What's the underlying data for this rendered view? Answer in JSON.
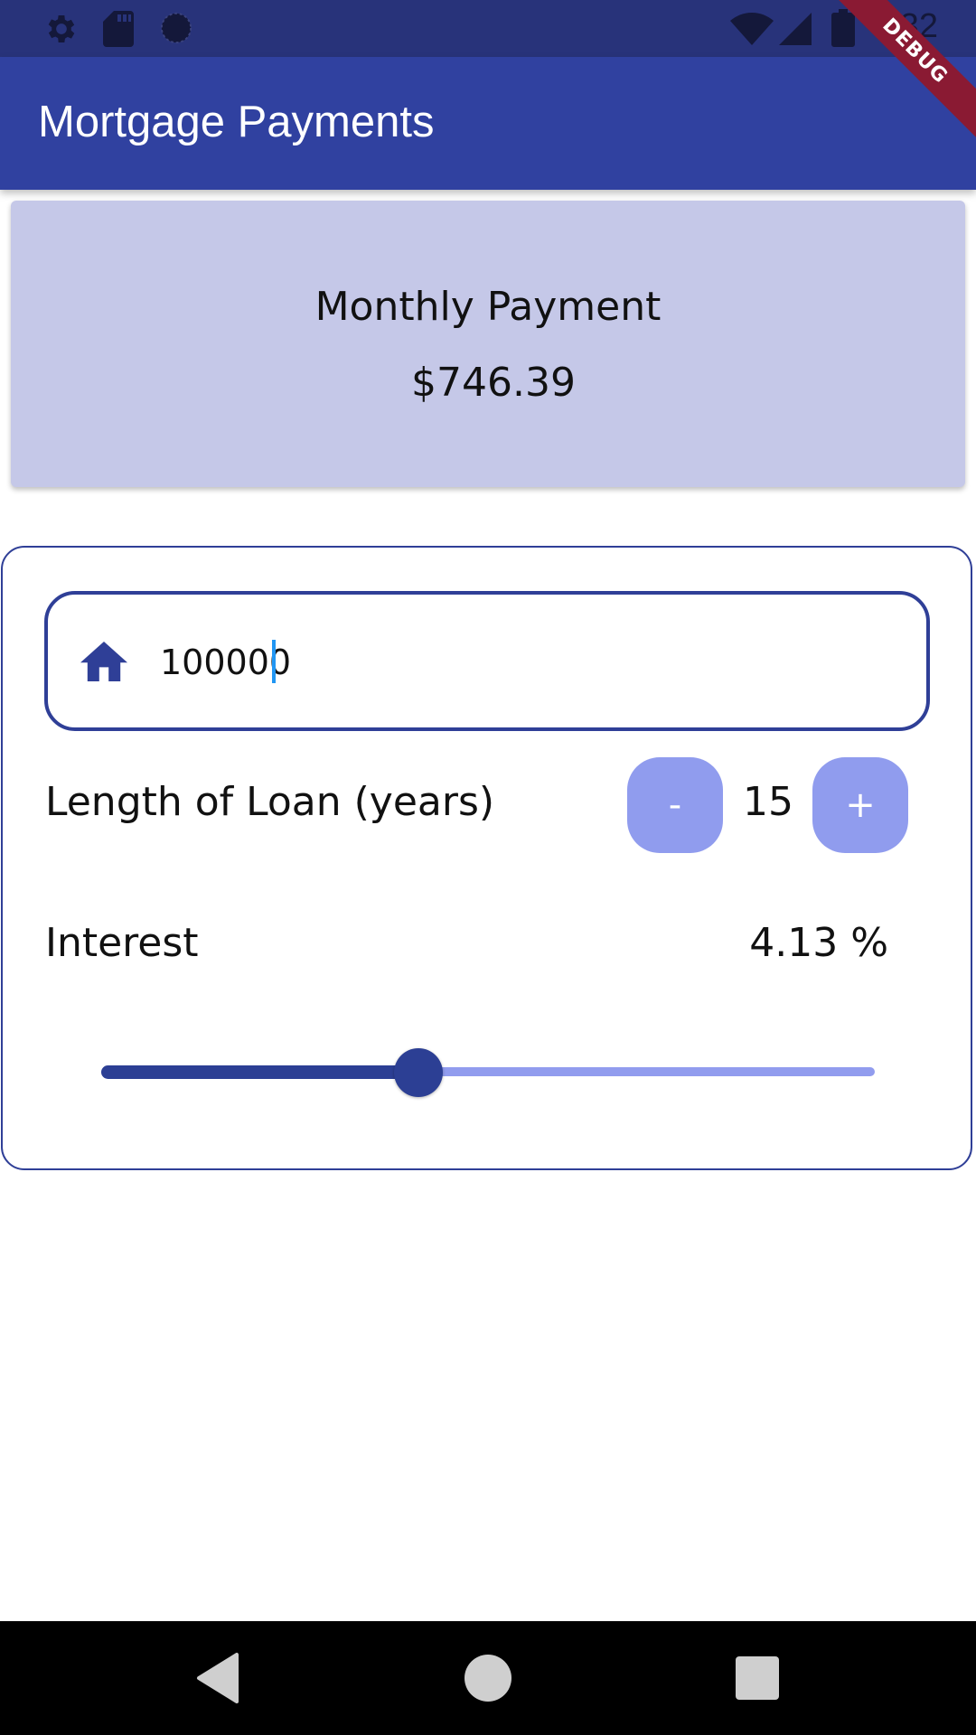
{
  "status_bar": {
    "time": "6:32",
    "icons": [
      "settings-icon",
      "sd-card-icon",
      "circle-icon",
      "wifi-icon",
      "signal-icon",
      "battery-icon"
    ]
  },
  "app_bar": {
    "title": "Mortgage Payments"
  },
  "debug_banner": {
    "label": "DEBUG"
  },
  "payment_card": {
    "label": "Monthly Payment",
    "value": "$746.39"
  },
  "loan_amount": {
    "value": "100000",
    "icon": "home-icon"
  },
  "loan_length": {
    "label": "Length of Loan (years)",
    "decrement_label": "-",
    "value": "15",
    "increment_label": "+"
  },
  "interest": {
    "label": "Interest",
    "value_text": "4.13 %",
    "slider_fraction": 0.41
  },
  "nav_bar": {
    "icons": [
      "back-icon",
      "home-circle-icon",
      "recents-icon"
    ]
  },
  "colors": {
    "primary": "#3041a0",
    "status_bar": "#28337a",
    "card_background": "#c5c8e8",
    "button_light": "#909cee",
    "debug_ribbon": "#8a1a33"
  }
}
